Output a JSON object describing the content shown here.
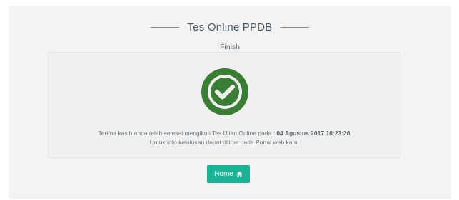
{
  "header": {
    "title": "Tes Online PPDB",
    "subtitle": "Finish"
  },
  "card": {
    "icon": "check-circle-icon",
    "message_prefix": "Terima kasih anda telah selesai mengikuti Tes Ujian Online pada : ",
    "message_datetime": "04 Agustus 2017 16:23:26",
    "message_line2": "Untuk info kelulusan dapat dilihat pada Portal web kami"
  },
  "actions": {
    "home_label": "Home",
    "home_icon": "home-icon"
  },
  "colors": {
    "check_green": "#3a7d35",
    "button_teal": "#1ab394"
  }
}
